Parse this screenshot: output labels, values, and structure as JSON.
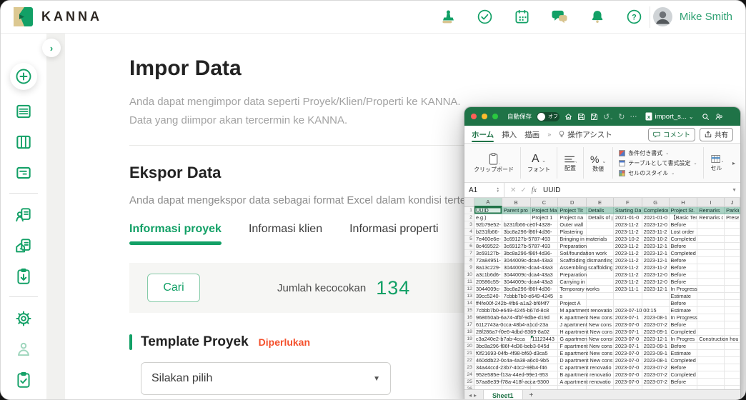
{
  "colors": {
    "accent": "#12A066",
    "excel_green": "#1F7347",
    "tan": "#D8C48F",
    "required_badge": "#F4502C"
  },
  "brand": {
    "name": "KANNA"
  },
  "header": {
    "user_name": "Mike Smith",
    "icons": [
      "stamp",
      "check-circle",
      "calendar",
      "chat",
      "bell",
      "help"
    ]
  },
  "sidebar": {
    "items": [
      "add",
      "project-list",
      "board",
      "notes",
      "client-list",
      "property-list",
      "import",
      "settings",
      "account",
      "tasks"
    ]
  },
  "page": {
    "title": "Impor Data",
    "intro_lines": [
      "Anda dapat mengimpor data seperti Proyek/Klien/Properti ke KANNA.",
      "Data yang diimpor akan tercermin ke KANNA."
    ],
    "export": {
      "title": "Ekspor Data",
      "description": "Anda dapat mengekspor data sebagai format Excel dalam kondisi tertentu.",
      "tabs": [
        {
          "label": "Informasi proyek",
          "active": true
        },
        {
          "label": "Informasi klien",
          "active": false
        },
        {
          "label": "Informasi properti",
          "active": false
        }
      ]
    },
    "search": {
      "button_label": "Cari",
      "match_label": "Jumlah kecocokan",
      "match_count": "134"
    },
    "template": {
      "label": "Template Proyek",
      "required_badge": "Diperlukan",
      "select_placeholder": "Silakan pilih"
    }
  },
  "excel": {
    "titlebar": {
      "autosave_label": "自動保存",
      "autosave_state": "オフ",
      "filename": "import_s...",
      "ellipsis": "⋯"
    },
    "ribbon_tabs": [
      {
        "label": "ホーム",
        "active": true
      },
      {
        "label": "挿入",
        "active": false
      },
      {
        "label": "描画",
        "active": false
      }
    ],
    "assist_label": "操作アシスト",
    "comment_label": "コメント",
    "share_label": "共有",
    "ribbon": {
      "groups": [
        "クリップボード",
        "フォント",
        "配置",
        "数値"
      ],
      "middle": [
        "条件付き書式",
        "テーブルとして書式設定",
        "セルのスタイル"
      ],
      "cells_label": "セル"
    },
    "formula": {
      "name_box": "A1",
      "fx": "fx",
      "value": "UUID"
    },
    "sheet": {
      "columns": [
        "A",
        "B",
        "C",
        "D",
        "E",
        "F",
        "G",
        "H",
        "I",
        "J"
      ],
      "active_sheet": "Sheet1",
      "note_cell": {
        "row": 19,
        "col": 2
      },
      "rows": [
        [
          "UUID",
          "Parent pro",
          "Project Ma",
          "Project Tit",
          "Details",
          "Starting Da",
          "Completion",
          "Project St.",
          "Remarks",
          "Parking s"
        ],
        [
          "e.g.)",
          "",
          "Project 1",
          "Project na",
          "Details of p",
          "2021-01-0",
          "2021-01-0",
          "【Basic Ter",
          "Remarks o",
          "Present,"
        ],
        [
          "92b79e52-",
          "b231fb66-ce0f-4328-",
          "",
          "Outer wall",
          "",
          "2023-11-2",
          "2023-12-0",
          "Before",
          "",
          ""
        ],
        [
          "b231fb66-",
          "3bc8a296-f86f-4d36-",
          "",
          "Plastering",
          "",
          "2023-11-2",
          "2023-11-2",
          "Lost order",
          "",
          ""
        ],
        [
          "7e460e6e-",
          "3c69127b-5787-493",
          "",
          "Bringing in materials",
          "",
          "2023-10-2",
          "2023-10-2",
          "Completed",
          "",
          ""
        ],
        [
          "8c469522-",
          "3c69127b-5787-493",
          "",
          "Preparation",
          "",
          "2023-11-2",
          "2023-12-1",
          "Before",
          "",
          ""
        ],
        [
          "3c69127b-",
          "3bc8a296-f86f-4d36-",
          "",
          "Soil/foundation work",
          "",
          "2023-11-2",
          "2023-12-1",
          "Completed",
          "",
          ""
        ],
        [
          "72a84951-",
          "3044009c-dca4-43a3",
          "",
          "Scaffolding dismantling",
          "",
          "2023-11-2",
          "2023-12-1",
          "Before",
          "",
          ""
        ],
        [
          "8a13c229-",
          "3044009c-dca4-43a3",
          "",
          "Assembling scaffolding",
          "",
          "2023-11-2",
          "2023-11-2",
          "Before",
          "",
          ""
        ],
        [
          "a3c1b6d6-",
          "3044009c-dca4-43a3",
          "",
          "Preparation",
          "",
          "2023-11-2",
          "2023-12-0",
          "Before",
          "",
          ""
        ],
        [
          "20586c55-",
          "3044009c-dca4-43a3",
          "",
          "Carrying in",
          "",
          "2023-11-2",
          "2023-12-0",
          "Before",
          "",
          ""
        ],
        [
          "3044009c-",
          "3bc8a296-f86f-4d36-",
          "",
          "Temporary works",
          "",
          "2023-11-1",
          "2023-12-1",
          "In Progress",
          "",
          ""
        ],
        [
          "39cc5240-",
          "7cbbb7b0-e649-4245",
          "",
          "s",
          "",
          "",
          "",
          "Estimate",
          "",
          ""
        ],
        [
          "ff4fe00f-242b-4fb6-a1a2-bf6f4f7",
          "",
          "",
          "Project A",
          "",
          "",
          "",
          "Before",
          "",
          ""
        ],
        [
          "7cbbb7b0-e649-4245-b67d-8c8",
          "",
          "",
          "M apartment renovatio",
          "",
          "2023-07-10 00:15",
          "",
          "Estimate",
          "",
          ""
        ],
        [
          "968650ab-6a74-4fbf-9dbe-d19d",
          "",
          "",
          "K apartment New cons",
          "",
          "2023-07-1",
          "2023-08-1",
          "In Progress",
          "",
          ""
        ],
        [
          "6112743a-0cca-48b4-a1cd-23a",
          "",
          "",
          "J apartment New cons",
          "",
          "2023-07-0",
          "2023-07-2",
          "Before",
          "",
          ""
        ],
        [
          "28f286a7-f0e6-4dbd-8369-8a02",
          "",
          "",
          "H apartment New cons",
          "",
          "2023-07-1",
          "2023-09-1",
          "Completed",
          "",
          ""
        ],
        [
          "c3a240e2-b7ab-4cca",
          "",
          "11123443",
          "G apartmen New const",
          "",
          "2023-07-0",
          "2023-12-1",
          "In Progres",
          "Construction hours",
          ""
        ],
        [
          "3bc8a296-f86f-4d36-beb3-045d",
          "",
          "",
          "F apartment New cons",
          "",
          "2023-07-1",
          "2023-09-1",
          "Before",
          "",
          ""
        ],
        [
          "f0f21693-04fb-4f98-bf60-d3ca5",
          "",
          "",
          "E apartment New cons",
          "",
          "2023-07-0",
          "2023-09-1",
          "Estimate",
          "",
          ""
        ],
        [
          "460ddb22-0c4a-4a38-a6c0-9b5",
          "",
          "",
          "D apartment New cons",
          "",
          "2023-07-0",
          "2023-08-1",
          "Completed",
          "",
          ""
        ],
        [
          "34a44ccd-23b7-40c2-98b4-f46",
          "",
          "",
          "C apartment renovatio",
          "",
          "2023-07-0",
          "2023-07-2",
          "Before",
          "",
          ""
        ],
        [
          "952e585e-f13a-44ed-99e1-953",
          "",
          "",
          "B apartment renovatio",
          "",
          "2023-07-0",
          "2023-07-2",
          "Completed",
          "",
          ""
        ],
        [
          "57aa8e39-f78a-418f-acca-9300",
          "",
          "",
          "A apartment renovatio",
          "",
          "2023-07-0",
          "2023-07-2",
          "Before",
          "",
          ""
        ],
        [
          "",
          "",
          "",
          "",
          "",
          "",
          "",
          "",
          "",
          ""
        ]
      ]
    }
  }
}
